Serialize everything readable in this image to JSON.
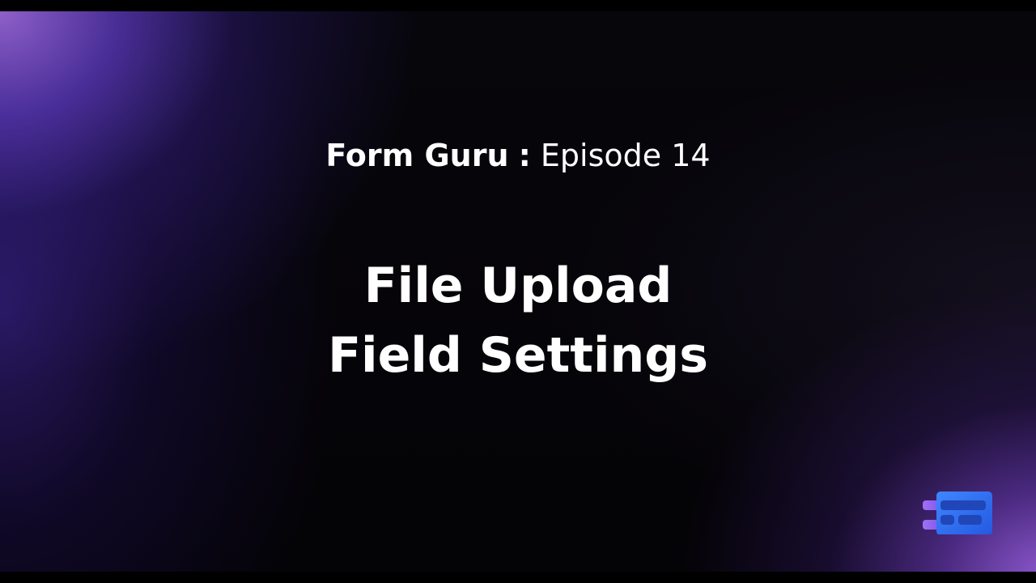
{
  "slide": {
    "series_name": "Form Guru",
    "separator": ":",
    "episode": "Episode 14",
    "title_lines": [
      "File Upload",
      "Field Settings"
    ]
  },
  "colors": {
    "background": "#050408",
    "glow_purple": "#7a4fd0",
    "text": "#ffffff",
    "logo_blue": "#2f6ff0",
    "logo_purple": "#8f5cf0"
  },
  "logo": {
    "icon": "form-builder-logo-icon"
  }
}
